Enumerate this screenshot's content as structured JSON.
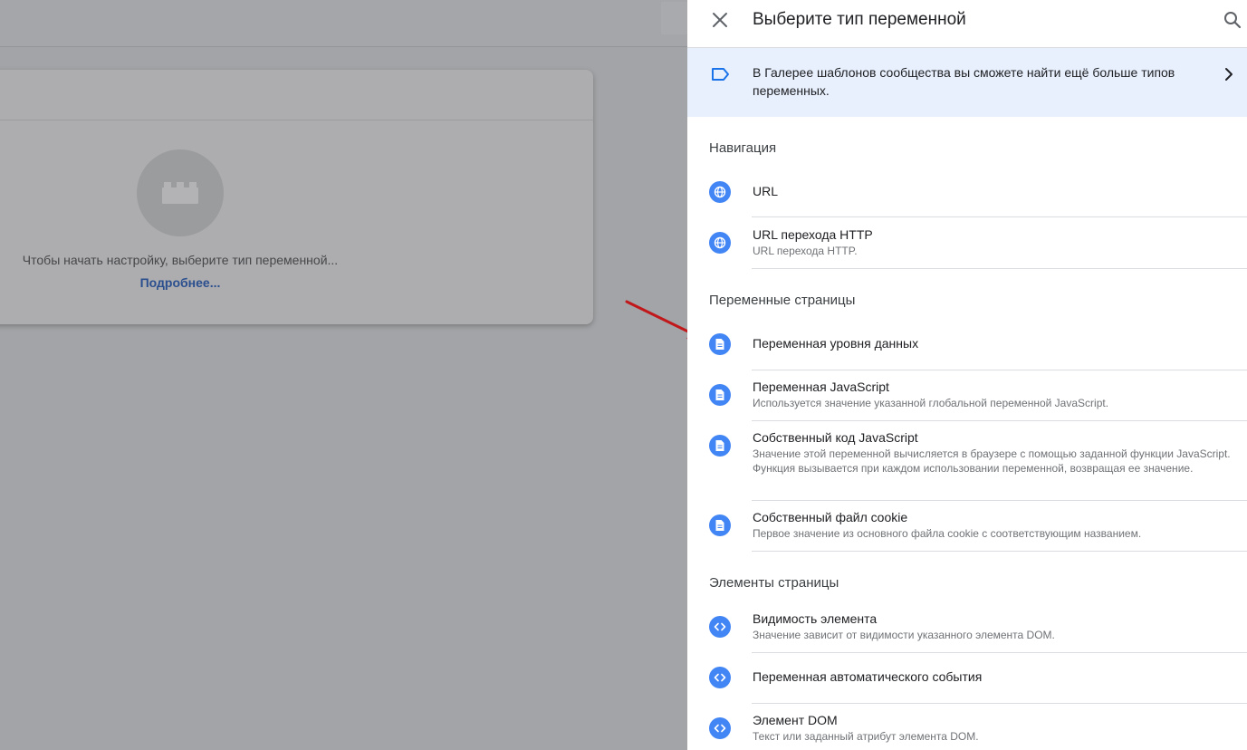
{
  "background": {
    "card": {
      "hint": "Чтобы начать настройку, выберите тип переменной...",
      "more_link": "Подробнее..."
    }
  },
  "panel": {
    "title": "Выберите тип переменной",
    "gallery_banner": "В Галерее шаблонов сообщества вы сможете найти ещё больше типов переменных.",
    "sections": {
      "navigation": {
        "title": "Навигация",
        "items": [
          {
            "title": "URL",
            "desc": ""
          },
          {
            "title": "URL перехода HTTP",
            "desc": "URL перехода HTTP."
          }
        ]
      },
      "page_vars": {
        "title": "Переменные страницы",
        "items": [
          {
            "title": "Переменная уровня данных",
            "desc": ""
          },
          {
            "title": "Переменная JavaScript",
            "desc": "Используется значение указанной глобальной переменной JavaScript."
          },
          {
            "title": "Собственный код JavaScript",
            "desc": "Значение этой переменной вычисляется в браузере с помощью заданной функции JavaScript. Функция вызывается при каждом использовании переменной, возвращая ее значение."
          },
          {
            "title": "Собственный файл cookie",
            "desc": "Первое значение из основного файла cookie с соответствующим названием."
          }
        ]
      },
      "page_elements": {
        "title": "Элементы страницы",
        "items": [
          {
            "title": "Видимость элемента",
            "desc": "Значение зависит от видимости указанного элемента DOM."
          },
          {
            "title": "Переменная автоматического события",
            "desc": ""
          },
          {
            "title": "Элемент DOM",
            "desc": "Текст или заданный атрибут элемента DOM."
          }
        ]
      }
    }
  },
  "icons": {
    "navigation": "globe-icon",
    "page_vars": "document-icon",
    "page_elements": "code-brackets-icon"
  },
  "colors": {
    "accent": "#4285f4",
    "banner_bg": "#e8f0fe",
    "annotation_arrow": "#c0181b"
  }
}
